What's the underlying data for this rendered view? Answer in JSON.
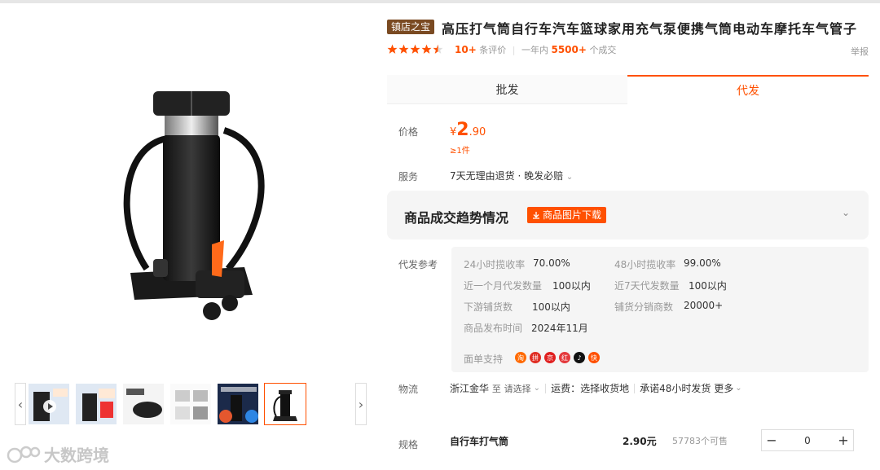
{
  "header": {
    "badge": "镇店之宝",
    "title": "高压打气筒自行车汽车篮球家用充气泵便携气筒电动车摩托车气管子",
    "rating_stars": 4.5,
    "review_count": "10+",
    "review_label": "条评价",
    "year_label": "一年内",
    "deals_count": "5500+",
    "deals_label": "个成交",
    "report": "举报"
  },
  "tabs": [
    {
      "label": "批发",
      "active": false
    },
    {
      "label": "代发",
      "active": true
    }
  ],
  "price": {
    "label": "价格",
    "currency": "¥",
    "integer": "2",
    "decimal": ".90",
    "min_qty": "≥1件"
  },
  "service": {
    "label": "服务",
    "text": "7天无理由退货 · 晚发必赔"
  },
  "trend": {
    "title": "商品成交趋势情况",
    "download_label": "商品图片下载"
  },
  "reference": {
    "label": "代发参考",
    "stats": [
      {
        "label": "24小时揽收率",
        "value": "70.00%"
      },
      {
        "label": "48小时揽收率",
        "value": "99.00%"
      },
      {
        "label": "近一个月代发数量",
        "value": "100以内"
      },
      {
        "label": "近7天代发数量",
        "value": "100以内"
      },
      {
        "label": "下游铺货数",
        "value": "100以内"
      },
      {
        "label": "铺货分销商数",
        "value": "20000+"
      },
      {
        "label": "商品发布时间",
        "value": "2024年11月"
      }
    ],
    "platform_label": "面单支持",
    "platform_colors": [
      "#ff6a00",
      "#e02e24",
      "#e02020",
      "#e4393c",
      "#111111",
      "#ff5000"
    ]
  },
  "logistics": {
    "label": "物流",
    "origin": "浙江金华",
    "to": "至",
    "choose": "请选择",
    "fee": "运费：选择收货地",
    "promise": "承诺48小时发货",
    "more": "更多"
  },
  "spec": {
    "label": "规格",
    "name": "自行车打气筒",
    "price": "2.90元",
    "stock": "57783个可售",
    "quantity": "0"
  },
  "watermark": "大数跨境",
  "colors": {
    "accent": "#ff5000",
    "badge": "#7a4a22"
  }
}
